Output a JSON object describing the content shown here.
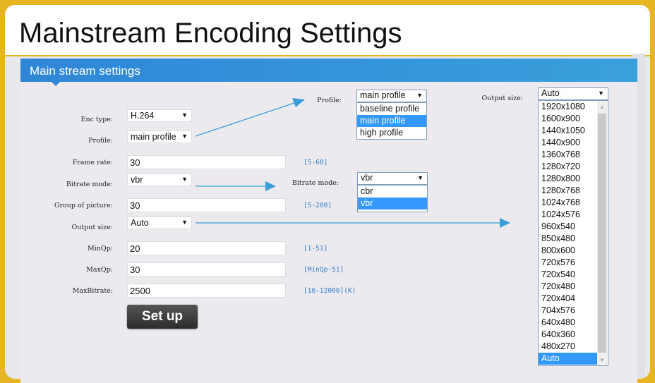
{
  "title": "Mainstream Encoding Settings",
  "panel_title": "Main stream settings",
  "form": {
    "enc_type": {
      "label": "Enc type:",
      "value": "H.264"
    },
    "profile": {
      "label": "Profile:",
      "value": "main profile"
    },
    "frame_rate": {
      "label": "Frame rate:",
      "value": "30",
      "hint": "[5-60]"
    },
    "bitrate_mode": {
      "label": "Bitrate mode:",
      "value": "vbr"
    },
    "gop": {
      "label": "Group of picture:",
      "value": "30",
      "hint": "[5-200]"
    },
    "output_size": {
      "label": "Output size:",
      "value": "Auto"
    },
    "min_qp": {
      "label": "MinQp:",
      "value": "20",
      "hint": "[1-51]"
    },
    "max_qp": {
      "label": "MaxQp:",
      "value": "30",
      "hint": "[MinQp-51]"
    },
    "max_bitrate": {
      "label": "MaxBitrate:",
      "value": "2500",
      "hint": "[16-12000](K)"
    },
    "setup_label": "Set up"
  },
  "profile_dropdown": {
    "label": "Profile:",
    "value": "main profile",
    "options": [
      "baseline profile",
      "main profile",
      "high profile"
    ],
    "selected": 1
  },
  "bitrate_dropdown": {
    "label": "Bitrate mode:",
    "value": "vbr",
    "options": [
      "cbr",
      "vbr"
    ],
    "selected": 1
  },
  "output_dropdown": {
    "label": "Output size:",
    "value": "Auto",
    "options": [
      "1920x1080",
      "1600x900",
      "1440x1050",
      "1440x900",
      "1360x768",
      "1280x720",
      "1280x800",
      "1280x768",
      "1024x768",
      "1024x576",
      "960x540",
      "850x480",
      "800x600",
      "720x576",
      "720x540",
      "720x480",
      "720x404",
      "704x576",
      "640x480",
      "640x360",
      "480x270",
      "Auto"
    ],
    "selected": 21
  },
  "colors": {
    "accent": "#2f86d6",
    "border": "#e6b521",
    "arrow": "#3a9fd8",
    "highlight": "#3399ff"
  }
}
